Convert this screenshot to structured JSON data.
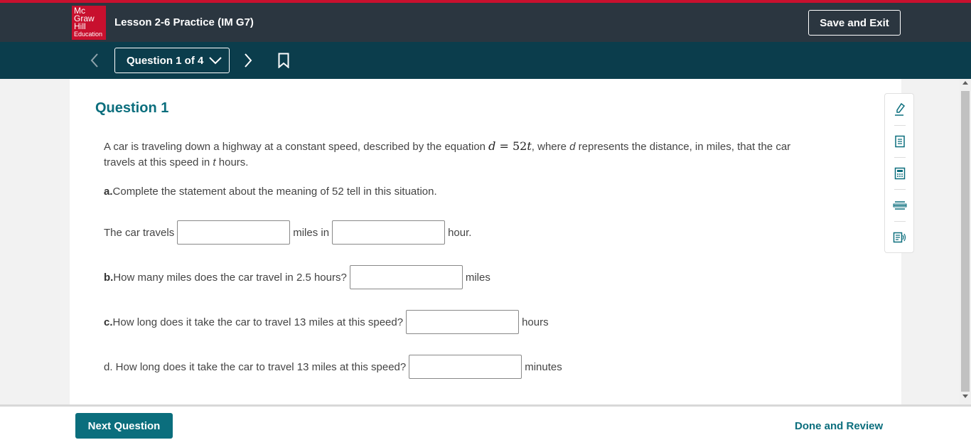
{
  "header": {
    "logo_lines": [
      "Mc",
      "Graw",
      "Hill",
      "Education"
    ],
    "title": "Lesson 2-6 Practice (IM G7)",
    "save_exit_label": "Save and Exit"
  },
  "nav": {
    "question_selector": "Question 1 of 4"
  },
  "question": {
    "heading": "Question 1",
    "prompt_before": "A car is traveling down a highway at a constant speed, described by the equation ",
    "eq_lhs": "d",
    "eq_op": " = ",
    "eq_rhs_num": "52",
    "eq_rhs_var": "t",
    "prompt_mid1": ", where ",
    "var_d": "d",
    "prompt_mid2": " represents the distance, in miles, that the car travels at this speed in ",
    "var_t": "t",
    "prompt_after": " hours.",
    "part_a": {
      "label": "a.",
      "text": " Complete the statement about the meaning of 52 tell in this situation."
    },
    "statement": {
      "before": "The car travels",
      "middle": "miles in",
      "after": "hour."
    },
    "part_b": {
      "label": "b.",
      "text": " How many miles does the car travel in 2.5 hours?",
      "unit": "miles"
    },
    "part_c": {
      "label": "c.",
      "text": " How long does it take the car to travel 13 miles at this speed?",
      "unit": "hours"
    },
    "part_d": {
      "text": "d.  How long does it take the car to travel 13 miles at this speed?",
      "unit": "minutes"
    }
  },
  "toolbar": {
    "tools": [
      "highlighter-icon",
      "notepad-icon",
      "calculator-icon",
      "line-reader-icon",
      "text-to-speech-icon"
    ]
  },
  "footer": {
    "next_label": "Next Question",
    "done_label": "Done and Review"
  },
  "colors": {
    "brand_red": "#c8102e",
    "header_bg": "#2b3640",
    "nav_bg": "#0b3d4c",
    "accent_teal": "#0b6e7d"
  }
}
